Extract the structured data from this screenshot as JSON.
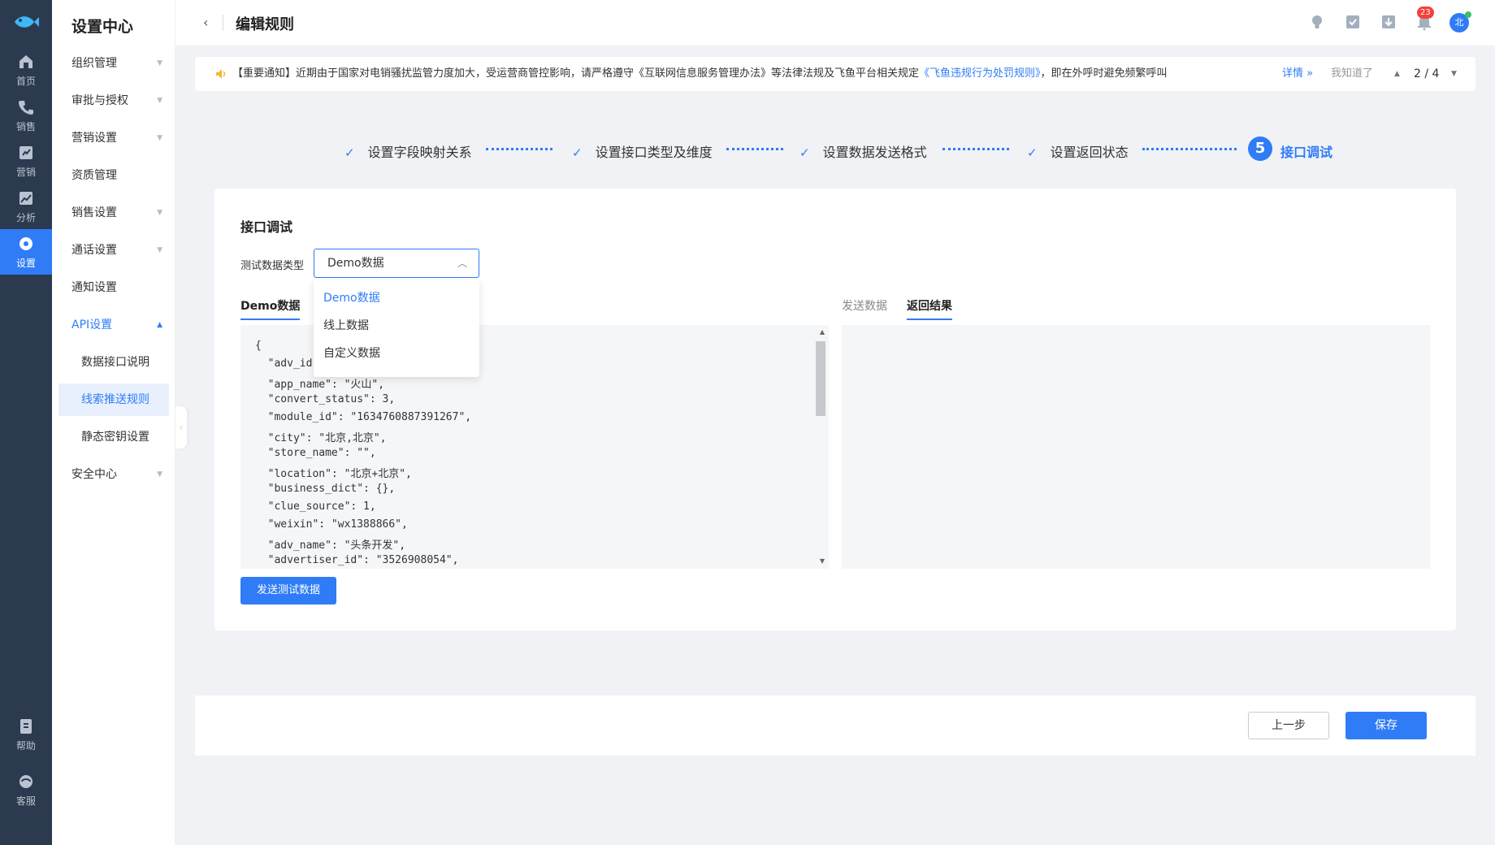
{
  "rail": {
    "items": [
      {
        "label": "首页",
        "icon": "home-icon"
      },
      {
        "label": "销售",
        "icon": "phone-icon"
      },
      {
        "label": "营销",
        "icon": "marketing-icon"
      },
      {
        "label": "分析",
        "icon": "analytics-icon"
      },
      {
        "label": "设置",
        "icon": "settings-icon"
      },
      {
        "label": "帮助",
        "icon": "help-icon"
      },
      {
        "label": "客服",
        "icon": "support-icon"
      }
    ]
  },
  "submenu": {
    "title": "设置中心",
    "items": [
      {
        "label": "组织管理"
      },
      {
        "label": "审批与授权"
      },
      {
        "label": "营销设置"
      },
      {
        "label": "资质管理"
      },
      {
        "label": "销售设置"
      },
      {
        "label": "通话设置"
      },
      {
        "label": "通知设置"
      },
      {
        "label": "API设置"
      },
      {
        "label": "数据接口说明"
      },
      {
        "label": "线索推送规则"
      },
      {
        "label": "静态密钥设置"
      },
      {
        "label": "安全中心"
      }
    ]
  },
  "header": {
    "title": "编辑规则",
    "notification_count": "23",
    "avatar_text": "北"
  },
  "notice": {
    "text_prefix": "【重要通知】近期由于国家对电销骚扰监管力度加大，受运营商管控影响，请严格遵守《互联网信息服务管理办法》等法律法规及飞鱼平台相关规定",
    "link_text": "《飞鱼违规行为处罚规则》",
    "text_suffix": "，即在外呼时避免频繁呼叫、...",
    "detail": "详情 »",
    "got_it": "我知道了",
    "pager": "2 / 4"
  },
  "steps": [
    {
      "label": "设置字段映射关系"
    },
    {
      "label": "设置接口类型及维度"
    },
    {
      "label": "设置数据发送格式"
    },
    {
      "label": "设置返回状态"
    },
    {
      "label": "接口调试",
      "number": "5"
    }
  ],
  "debug": {
    "title": "接口调试",
    "data_type_label": "测试数据类型",
    "data_type_value": "Demo数据",
    "options": [
      "Demo数据",
      "线上数据",
      "自定义数据"
    ],
    "left_tab": "Demo数据",
    "right_tabs": [
      "发送数据",
      "返回结果"
    ],
    "code_lines": [
      "{",
      "  \"adv_id\": 1",
      "  \"app_name\": \"火山\",",
      "  \"convert_status\": 3,",
      "  \"module_id\": \"1634760887391267\",",
      "  \"city\": \"北京,北京\",",
      "  \"store_name\": \"\",",
      "  \"location\": \"北京+北京\",",
      "  \"business_dict\": {},",
      "  \"clue_source\": 1,",
      "  \"weixin\": \"wx1388866\",",
      "  \"adv_name\": \"头条开发\",",
      "  \"advertiser_id\": \"3526908054\","
    ],
    "send_button": "发送测试数据"
  },
  "footer": {
    "prev_button": "上一步",
    "save_button": "保存"
  },
  "colors": {
    "accent": "#2f7cf6",
    "rail_bg": "#2b3a4e",
    "badge": "#f5413b"
  }
}
